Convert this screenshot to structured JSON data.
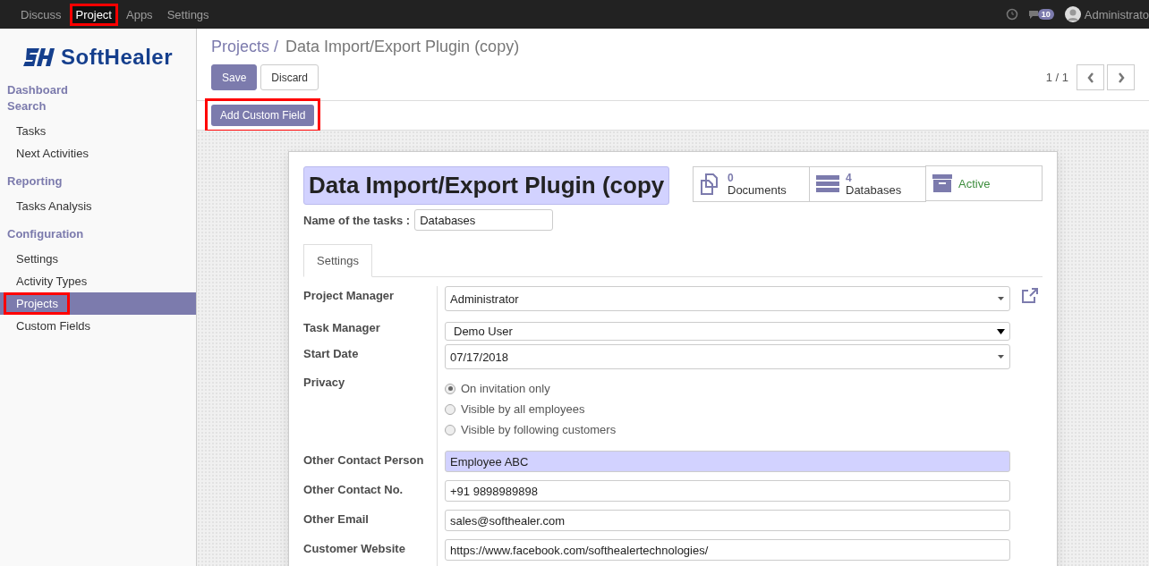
{
  "topbar": {
    "menus": [
      {
        "label": "Discuss",
        "selected": false,
        "highlighted": false
      },
      {
        "label": "Project",
        "selected": true,
        "highlighted": true
      },
      {
        "label": "Apps",
        "selected": false,
        "highlighted": false
      },
      {
        "label": "Settings",
        "selected": false,
        "highlighted": false
      }
    ],
    "message_count": "10",
    "user": "Administrato"
  },
  "sidebar": {
    "logo": "SoftHealer",
    "sections": [
      {
        "title": "Dashboard"
      },
      {
        "title": "Search",
        "items": [
          {
            "label": "Tasks",
            "selected": false,
            "highlighted": false
          },
          {
            "label": "Next Activities",
            "selected": false,
            "highlighted": false
          }
        ]
      },
      {
        "title": "Reporting",
        "items": [
          {
            "label": "Tasks Analysis",
            "selected": false,
            "highlighted": false
          }
        ]
      },
      {
        "title": "Configuration",
        "items": [
          {
            "label": "Settings",
            "selected": false,
            "highlighted": false
          },
          {
            "label": "Activity Types",
            "selected": false,
            "highlighted": false
          },
          {
            "label": "Projects",
            "selected": true,
            "highlighted": true
          },
          {
            "label": "Custom Fields",
            "selected": false,
            "highlighted": false
          }
        ]
      }
    ]
  },
  "breadcrumb": {
    "parent": "Projects /",
    "current": "Data Import/Export Plugin (copy)"
  },
  "buttons": {
    "save": "Save",
    "discard": "Discard"
  },
  "pager": "1 / 1",
  "toolbar": {
    "button": "Add Custom Field",
    "highlighted": true
  },
  "form": {
    "title": "Data Import/Export Plugin (copy",
    "title_required": true,
    "stat_buttons": [
      {
        "kind": "documents",
        "count": "0",
        "label": "Documents"
      },
      {
        "kind": "databases",
        "count": "4",
        "label": "Databases"
      },
      {
        "kind": "archive",
        "label": "Active"
      }
    ],
    "task_name": {
      "label": "Name of the tasks :",
      "value": "Databases"
    },
    "tabs": [
      {
        "label": "Settings",
        "selected": true
      }
    ],
    "fields": [
      {
        "kind": "many2one",
        "label": "Project Manager",
        "value": "Administrator",
        "required": false,
        "external_link": true
      },
      {
        "kind": "select",
        "label": "Task Manager",
        "value": "Demo User",
        "required": false
      },
      {
        "kind": "many2one",
        "label": "Start Date",
        "value": "07/17/2018",
        "required": false
      },
      {
        "kind": "radio",
        "label": "Privacy",
        "options": [
          {
            "label": "On invitation only",
            "selected": true
          },
          {
            "label": "Visible by all employees",
            "selected": false
          },
          {
            "label": "Visible by following customers",
            "selected": false
          }
        ]
      },
      {
        "kind": "text",
        "label": "Other Contact Person",
        "value": "Employee ABC",
        "required": true
      },
      {
        "kind": "text",
        "label": "Other Contact No.",
        "value": "+91 9898989898",
        "required": false
      },
      {
        "kind": "text",
        "label": "Other Email",
        "value": "sales@softhealer.com",
        "required": false
      },
      {
        "kind": "text",
        "label": "Customer Website",
        "value": "https://www.facebook.com/softhealertechnologies/",
        "required": false
      }
    ]
  }
}
